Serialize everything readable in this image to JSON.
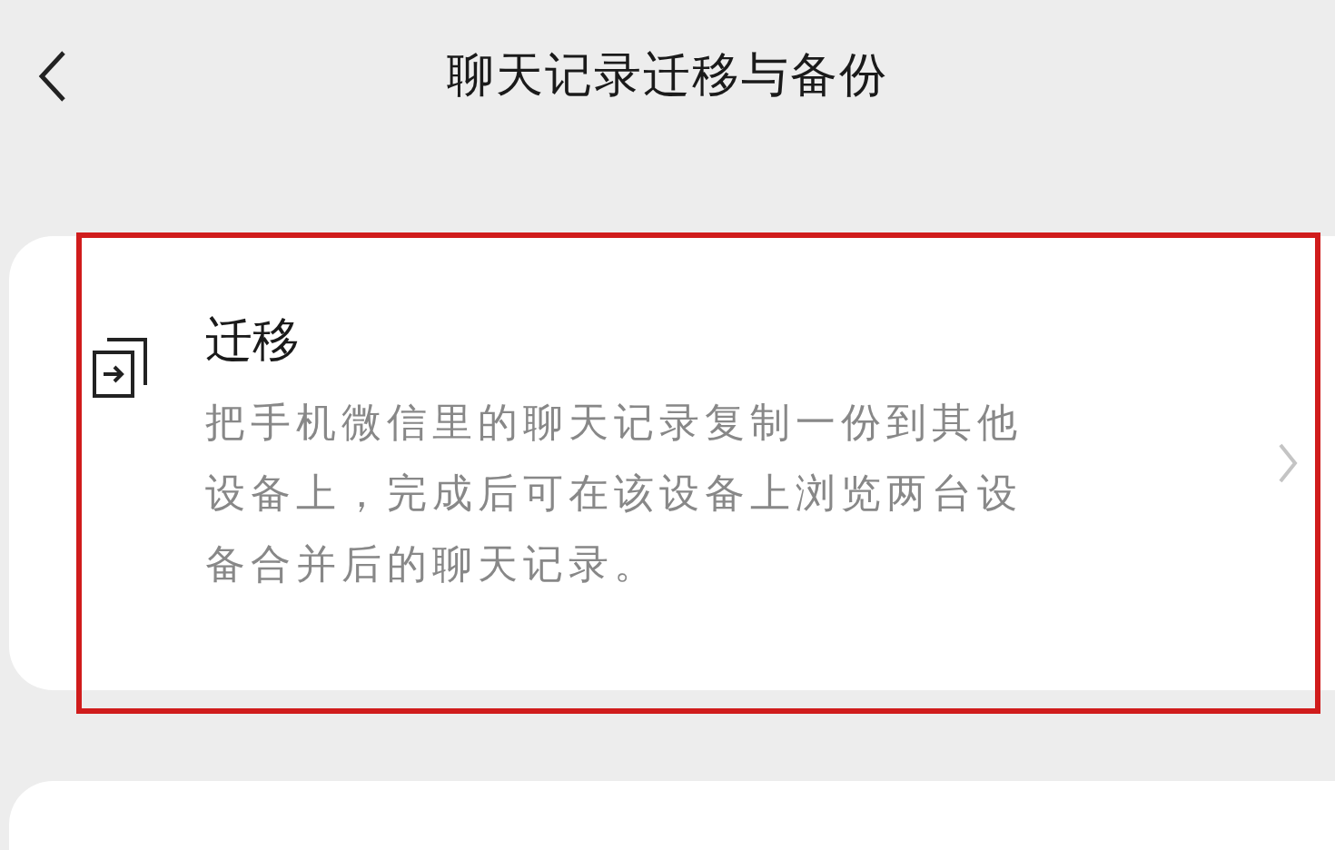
{
  "header": {
    "title": "聊天记录迁移与备份"
  },
  "options": [
    {
      "title": "迁移",
      "description": "把手机微信里的聊天记录复制一份到其他设备上，完成后可在该设备上浏览两台设备合并后的聊天记录。",
      "highlighted": true
    }
  ]
}
